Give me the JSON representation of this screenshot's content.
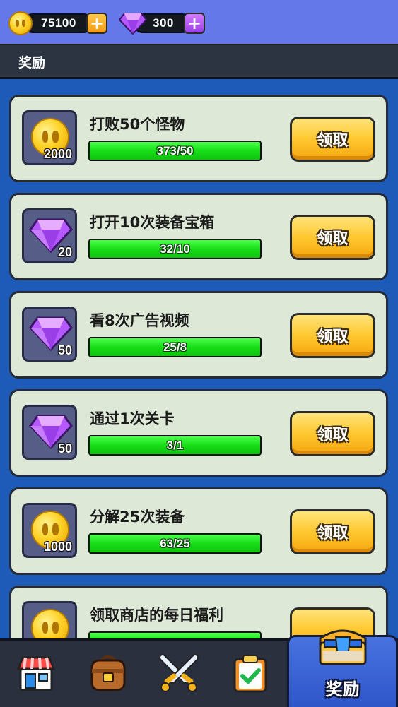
{
  "currency": {
    "coins": "75100",
    "gems": "300"
  },
  "header": {
    "title": "奖励"
  },
  "tasks": [
    {
      "title": "打败50个怪物",
      "reward_type": "coin",
      "reward": "2000",
      "progress_text": "373/50",
      "progress": 1.0,
      "button": "领取"
    },
    {
      "title": "打开10次装备宝箱",
      "reward_type": "gem",
      "reward": "20",
      "progress_text": "32/10",
      "progress": 1.0,
      "button": "领取"
    },
    {
      "title": "看8次广告视频",
      "reward_type": "gem",
      "reward": "50",
      "progress_text": "25/8",
      "progress": 1.0,
      "button": "领取"
    },
    {
      "title": "通过1次关卡",
      "reward_type": "gem",
      "reward": "50",
      "progress_text": "3/1",
      "progress": 1.0,
      "button": "领取"
    },
    {
      "title": "分解25次装备",
      "reward_type": "coin",
      "reward": "1000",
      "progress_text": "63/25",
      "progress": 1.0,
      "button": "领取"
    },
    {
      "title": "领取商店的每日福利",
      "reward_type": "coin",
      "reward": "",
      "progress_text": "",
      "progress": 1.0,
      "button": ""
    }
  ],
  "nav": {
    "items": [
      {
        "icon": "shop-icon"
      },
      {
        "icon": "backpack-icon"
      },
      {
        "icon": "crossed-swords-icon"
      },
      {
        "icon": "clipboard-check-icon"
      },
      {
        "icon": "treasure-chest-icon",
        "label": "奖励",
        "active": true
      }
    ]
  },
  "colors": {
    "background": "#1e5bb8",
    "topbar": "#6478ea",
    "card": "#dde8d7",
    "progress_fill": "#17de17",
    "button": "#ffc830"
  }
}
